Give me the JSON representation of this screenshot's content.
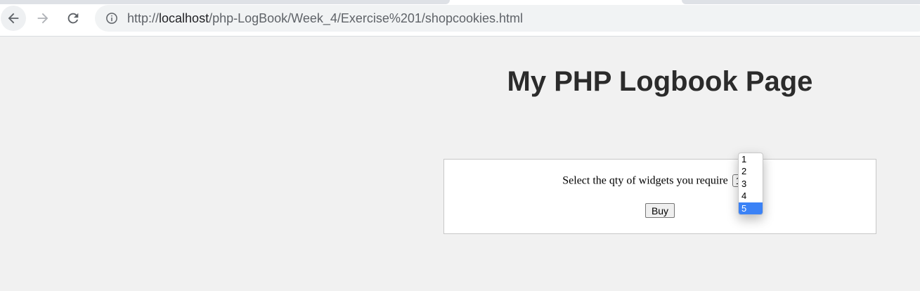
{
  "browser": {
    "url_prefix": "http://",
    "url_host": "localhost",
    "url_path": "/php-LogBook/Week_4/Exercise%201/shopcookies.html"
  },
  "page": {
    "title": "My PHP Logbook Page"
  },
  "form": {
    "qty_label": "Select the qty of widgets you require",
    "qty_selected": "1",
    "qty_options": [
      "1",
      "2",
      "3",
      "4",
      "5"
    ],
    "highlighted_option": "5",
    "buy_label": "Buy"
  },
  "colors": {
    "page_background": "#f1f1f1",
    "highlight": "#3b82f6"
  },
  "icons": {
    "back": "back-arrow-icon",
    "forward": "forward-arrow-icon",
    "reload": "reload-icon",
    "info": "info-icon",
    "chevron": "chevron-down-icon"
  }
}
